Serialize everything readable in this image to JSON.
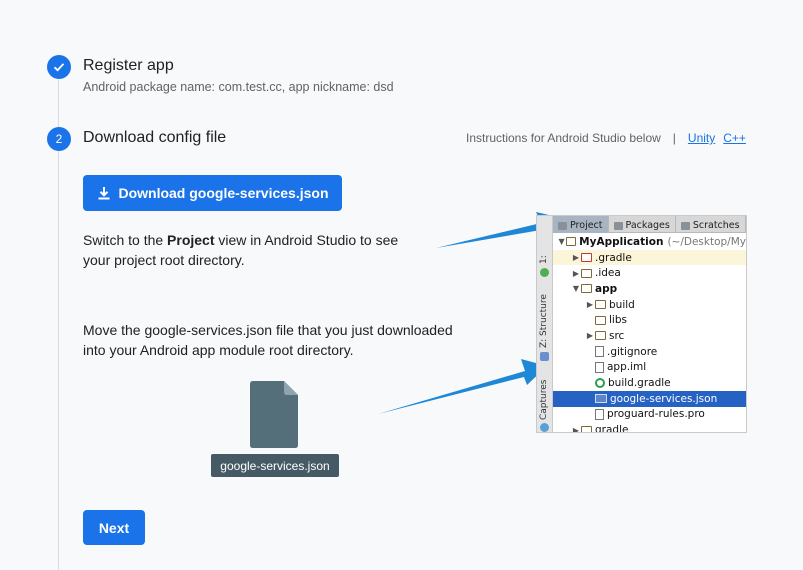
{
  "steps": [
    {
      "marker": "✓",
      "title": "Register app",
      "subtitle": "Android package name: com.test.cc, app nickname: dsd"
    },
    {
      "marker": "2",
      "title": "Download config file"
    }
  ],
  "instructions": {
    "text": "Instructions for Android Studio below",
    "separator": "|",
    "links": [
      "Unity",
      "C++"
    ]
  },
  "download_button": {
    "label": "Download google-services.json",
    "icon": "download-icon"
  },
  "paragraph1": {
    "before": "Switch to the ",
    "bold": "Project",
    "after": " view in Android Studio to see your project root directory."
  },
  "paragraph2": "Move the google-services.json file that you just downloaded into your Android app module root directory.",
  "file_graphic": {
    "label": "google-services.json",
    "icon": "file-icon"
  },
  "next_button": {
    "label": "Next"
  },
  "studio": {
    "tabs": [
      "Project",
      "Packages",
      "Scratches"
    ],
    "side_tabs": [
      "1:",
      "Z: Structure",
      "Captures"
    ],
    "tree": [
      {
        "name": "MyApplication",
        "extra": "(~/Desktop/My",
        "bold": true,
        "toggle": "▼",
        "depth": 0,
        "icon": "module-icon",
        "highlight": ""
      },
      {
        "name": ".gradle",
        "toggle": "▶",
        "depth": 1,
        "icon": "folder-red-icon",
        "highlight": "yellow"
      },
      {
        "name": ".idea",
        "toggle": "▶",
        "depth": 1,
        "icon": "folder-icon",
        "highlight": ""
      },
      {
        "name": "app",
        "bold": true,
        "toggle": "▼",
        "depth": 1,
        "icon": "module-folder-icon",
        "highlight": ""
      },
      {
        "name": "build",
        "toggle": "▶",
        "depth": 2,
        "icon": "folder-icon",
        "highlight": ""
      },
      {
        "name": "libs",
        "toggle": "",
        "depth": 2,
        "icon": "folder-icon",
        "highlight": ""
      },
      {
        "name": "src",
        "toggle": "▶",
        "depth": 2,
        "icon": "folder-icon",
        "highlight": ""
      },
      {
        "name": ".gitignore",
        "toggle": "",
        "depth": 2,
        "icon": "file-icon",
        "highlight": ""
      },
      {
        "name": "app.iml",
        "toggle": "",
        "depth": 2,
        "icon": "file-icon",
        "highlight": ""
      },
      {
        "name": "build.gradle",
        "toggle": "",
        "depth": 2,
        "icon": "gradle-icon",
        "highlight": ""
      },
      {
        "name": "google-services.json",
        "toggle": "",
        "depth": 2,
        "icon": "json-icon",
        "highlight": "selected"
      },
      {
        "name": "proguard-rules.pro",
        "toggle": "",
        "depth": 2,
        "icon": "file-icon",
        "highlight": ""
      },
      {
        "name": "gradle",
        "toggle": "▶",
        "depth": 1,
        "icon": "folder-icon",
        "highlight": ""
      }
    ]
  },
  "colors": {
    "accent": "#1a73e8",
    "arrow": "#1e88d6",
    "file": "#546e7a",
    "file_label_bg": "#455a64",
    "selected_row": "#2662c4"
  }
}
